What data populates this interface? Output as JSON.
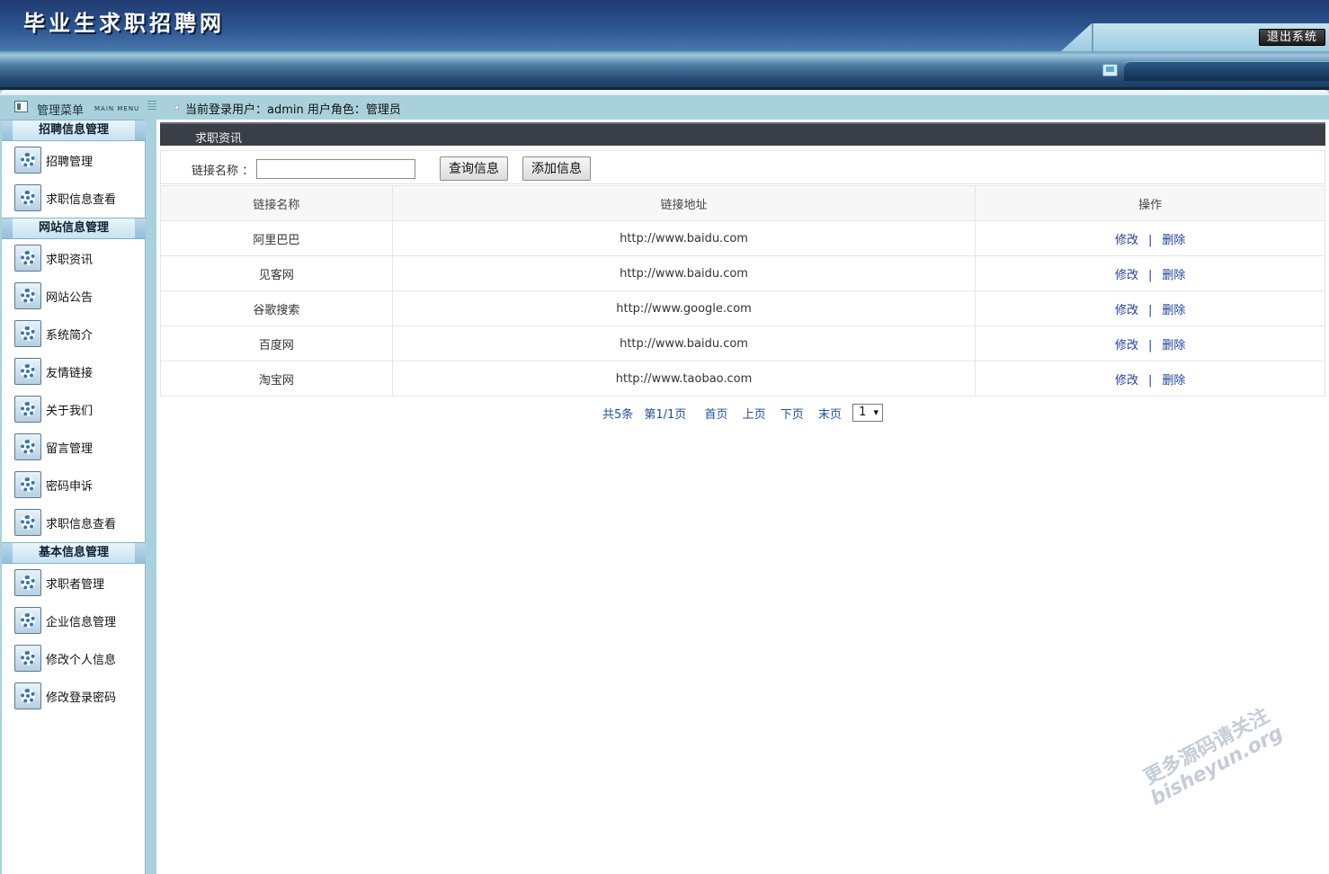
{
  "header": {
    "site_title": "毕业生求职招聘网",
    "logout_label": "退出系统",
    "monitor_icon": "monitor-icon"
  },
  "menu_header": {
    "title": "管理菜单",
    "subtitle": "MAIN MENU"
  },
  "status": {
    "text": "当前登录用户：admin  用户角色：管理员"
  },
  "sidebar": {
    "item_icon": "gear-icon",
    "groups": [
      {
        "title": "招聘信息管理",
        "items": [
          "招聘管理",
          "求职信息查看"
        ]
      },
      {
        "title": "网站信息管理",
        "items": [
          "求职资讯",
          "网站公告",
          "系统简介",
          "友情链接",
          "关于我们",
          "留言管理",
          "密码申诉",
          "求职信息查看"
        ]
      },
      {
        "title": "基本信息管理",
        "items": [
          "求职者管理",
          "企业信息管理",
          "修改个人信息",
          "修改登录密码"
        ]
      }
    ]
  },
  "panel": {
    "title": "求职资讯",
    "search_label": "链接名称 ：",
    "search_value": "",
    "query_button": "查询信息",
    "add_button": "添加信息"
  },
  "table": {
    "headers": [
      "链接名称",
      "链接地址",
      "操作"
    ],
    "edit_label": "修改",
    "separator": "|",
    "delete_label": "删除",
    "rows": [
      {
        "name": "阿里巴巴",
        "url": "http://www.baidu.com"
      },
      {
        "name": "见客网",
        "url": "http://www.baidu.com"
      },
      {
        "name": "谷歌搜索",
        "url": "http://www.google.com"
      },
      {
        "name": "百度网",
        "url": "http://www.baidu.com"
      },
      {
        "name": "淘宝网",
        "url": "http://www.taobao.com"
      }
    ]
  },
  "pagination": {
    "total": "共5条",
    "page_info": "第1/1页",
    "first": "首页",
    "prev": "上页",
    "next": "下页",
    "last": "末页",
    "selected_page": "1"
  },
  "watermark": {
    "line1": "更多源码请关注",
    "line2": "bisheyun.org"
  }
}
